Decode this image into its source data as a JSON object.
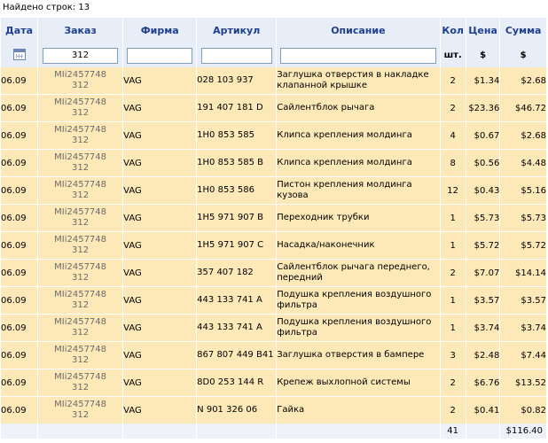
{
  "status": {
    "found_text": "Найдено строк: 13"
  },
  "headers": {
    "date": "Дата",
    "order": "Заказ",
    "brand": "Фирма",
    "article": "Артикул",
    "description": "Описание",
    "qty": "Кол",
    "price": "Цена",
    "sum": "Сумма"
  },
  "filters": {
    "order_value": "312",
    "brand_value": "",
    "article_value": "",
    "description_value": "",
    "qty_unit": "шт.",
    "price_currency": "$",
    "sum_currency": "$",
    "date_icon": "calendar-icon"
  },
  "rows": [
    {
      "date": "06.09",
      "order_code": "MIi2457748",
      "order_num": "312",
      "brand": "VAG",
      "article": "028 103 937",
      "description": "Заглушка отверстия в накладке клапанной крышке",
      "qty": "2",
      "price": "$1.34",
      "sum": "$2.68"
    },
    {
      "date": "06.09",
      "order_code": "MIi2457748",
      "order_num": "312",
      "brand": "VAG",
      "article": "191 407 181 D",
      "description": "Сайлентблок рычага",
      "qty": "2",
      "price": "$23.36",
      "sum": "$46.72"
    },
    {
      "date": "06.09",
      "order_code": "MIi2457748",
      "order_num": "312",
      "brand": "VAG",
      "article": "1H0 853 585",
      "description": "Клипса крепления молдинга",
      "qty": "4",
      "price": "$0.67",
      "sum": "$2.68"
    },
    {
      "date": "06.09",
      "order_code": "MIi2457748",
      "order_num": "312",
      "brand": "VAG",
      "article": "1H0 853 585 B",
      "description": "Клипса крепления молдинга",
      "qty": "8",
      "price": "$0.56",
      "sum": "$4.48"
    },
    {
      "date": "06.09",
      "order_code": "MIi2457748",
      "order_num": "312",
      "brand": "VAG",
      "article": "1H0 853 586",
      "description": "Пистон крепления молдинга кузова",
      "qty": "12",
      "price": "$0.43",
      "sum": "$5.16"
    },
    {
      "date": "06.09",
      "order_code": "MIi2457748",
      "order_num": "312",
      "brand": "VAG",
      "article": "1H5 971 907 B",
      "description": "Переходник трубки",
      "qty": "1",
      "price": "$5.73",
      "sum": "$5.73"
    },
    {
      "date": "06.09",
      "order_code": "MIi2457748",
      "order_num": "312",
      "brand": "VAG",
      "article": "1H5 971 907 C",
      "description": "Насадка/наконечник",
      "qty": "1",
      "price": "$5.72",
      "sum": "$5.72"
    },
    {
      "date": "06.09",
      "order_code": "MIi2457748",
      "order_num": "312",
      "brand": "VAG",
      "article": "357 407 182",
      "description": "Сайлентблок рычага переднего, передний",
      "qty": "2",
      "price": "$7.07",
      "sum": "$14.14"
    },
    {
      "date": "06.09",
      "order_code": "MIi2457748",
      "order_num": "312",
      "brand": "VAG",
      "article": "443 133 741 A",
      "description": "Подушка крепления воздушного фильтра",
      "qty": "1",
      "price": "$3.57",
      "sum": "$3.57"
    },
    {
      "date": "06.09",
      "order_code": "MIi2457748",
      "order_num": "312",
      "brand": "VAG",
      "article": "443 133 741 A",
      "description": "Подушка крепления воздушного фильтра",
      "qty": "1",
      "price": "$3.74",
      "sum": "$3.74"
    },
    {
      "date": "06.09",
      "order_code": "MIi2457748",
      "order_num": "312",
      "brand": "VAG",
      "article": "867 807 449 B41",
      "description": "Заглушка отверстия в бампере",
      "qty": "3",
      "price": "$2.48",
      "sum": "$7.44"
    },
    {
      "date": "06.09",
      "order_code": "MIi2457748",
      "order_num": "312",
      "brand": "VAG",
      "article": "8D0 253 144 R",
      "description": "Крепеж выхлопной системы",
      "qty": "2",
      "price": "$6.76",
      "sum": "$13.52"
    },
    {
      "date": "06.09",
      "order_code": "MIi2457748",
      "order_num": "312",
      "brand": "VAG",
      "article": "N 901 326 06",
      "description": "Гайка",
      "qty": "2",
      "price": "$0.41",
      "sum": "$0.82"
    }
  ],
  "totals": {
    "qty": "41",
    "sum": "$116.40"
  },
  "colors": {
    "header_bg": "#e8eef7",
    "header_text": "#1f3f8f",
    "row_bg": "#fde9b8",
    "order_text": "#6b6b6b"
  }
}
